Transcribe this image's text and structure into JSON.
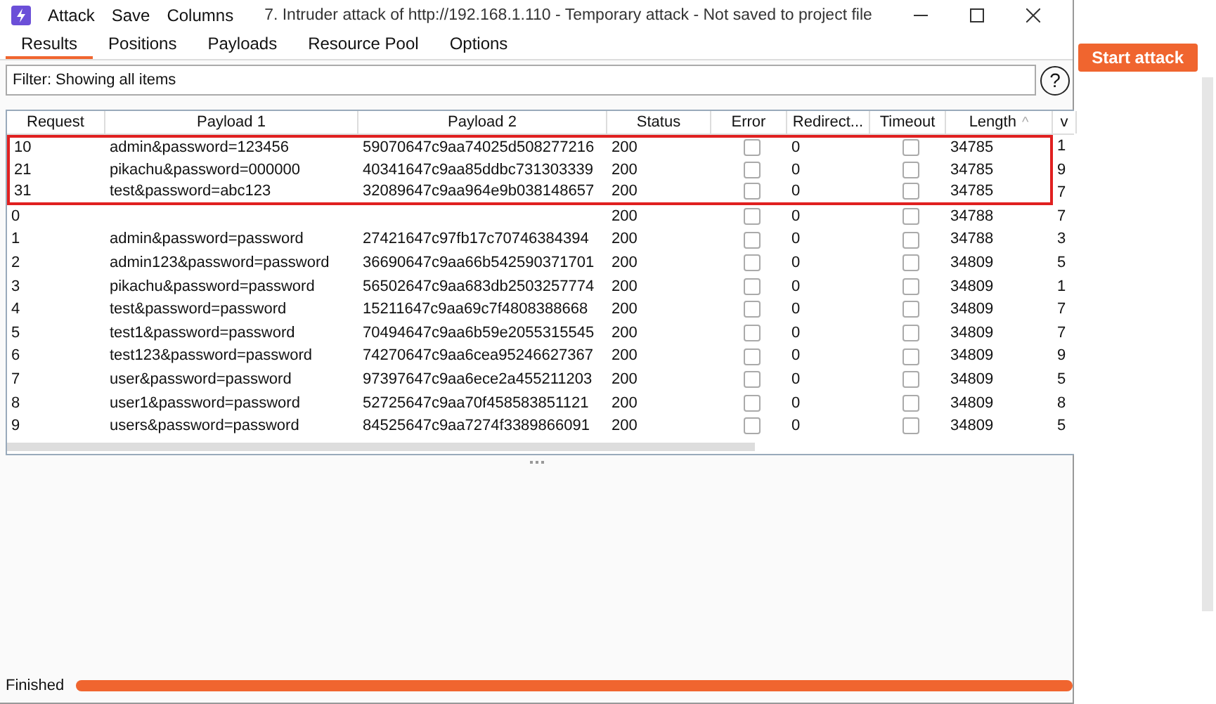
{
  "window": {
    "menu": [
      "Attack",
      "Save",
      "Columns"
    ],
    "title": "7. Intruder attack of http://192.168.1.110 - Temporary attack - Not saved to project file"
  },
  "tabs": [
    {
      "label": "Results",
      "selected": true
    },
    {
      "label": "Positions",
      "selected": false
    },
    {
      "label": "Payloads",
      "selected": false
    },
    {
      "label": "Resource Pool",
      "selected": false
    },
    {
      "label": "Options",
      "selected": false
    }
  ],
  "filter": {
    "text": "Filter: Showing all items",
    "help": "?"
  },
  "table": {
    "columns": [
      "Request",
      "Payload 1",
      "Payload 2",
      "Status",
      "Error",
      "Redirect...",
      "Timeout",
      "Length",
      "v"
    ],
    "sort_mark": "^",
    "rows": [
      {
        "request": "10",
        "payload_1": "admin&password=123456",
        "payload_2": "59070647c9aa74025d508277216",
        "status": "200",
        "error": false,
        "redirects": "0",
        "timeout": false,
        "length": "34785",
        "column_9": "1",
        "highlighted": true
      },
      {
        "request": "21",
        "payload_1": "pikachu&password=000000",
        "payload_2": "40341647c9aa85ddbc731303339",
        "status": "200",
        "error": false,
        "redirects": "0",
        "timeout": false,
        "length": "34785",
        "column_9": "9",
        "highlighted": true
      },
      {
        "request": "31",
        "payload_1": "test&password=abc123",
        "payload_2": "32089647c9aa964e9b038148657",
        "status": "200",
        "error": false,
        "redirects": "0",
        "timeout": false,
        "length": "34785",
        "column_9": "7",
        "highlighted": true
      },
      {
        "request": "0",
        "payload_1": "",
        "payload_2": "",
        "status": "200",
        "error": false,
        "redirects": "0",
        "timeout": false,
        "length": "34788",
        "column_9": "7",
        "highlighted": false
      },
      {
        "request": "1",
        "payload_1": "admin&password=password",
        "payload_2": "27421647c97fb17c70746384394",
        "status": "200",
        "error": false,
        "redirects": "0",
        "timeout": false,
        "length": "34788",
        "column_9": "3",
        "highlighted": false
      },
      {
        "request": "2",
        "payload_1": "admin123&password=password",
        "payload_2": "36690647c9aa66b542590371701",
        "status": "200",
        "error": false,
        "redirects": "0",
        "timeout": false,
        "length": "34809",
        "column_9": "5",
        "highlighted": false
      },
      {
        "request": "3",
        "payload_1": "pikachu&password=password",
        "payload_2": "56502647c9aa683db2503257774",
        "status": "200",
        "error": false,
        "redirects": "0",
        "timeout": false,
        "length": "34809",
        "column_9": "1",
        "highlighted": false
      },
      {
        "request": "4",
        "payload_1": "test&password=password",
        "payload_2": "15211647c9aa69c7f4808388668",
        "status": "200",
        "error": false,
        "redirects": "0",
        "timeout": false,
        "length": "34809",
        "column_9": "7",
        "highlighted": false
      },
      {
        "request": "5",
        "payload_1": "test1&password=password",
        "payload_2": "70494647c9aa6b59e2055315545",
        "status": "200",
        "error": false,
        "redirects": "0",
        "timeout": false,
        "length": "34809",
        "column_9": "7",
        "highlighted": false
      },
      {
        "request": "6",
        "payload_1": "test123&password=password",
        "payload_2": "74270647c9aa6cea95246627367",
        "status": "200",
        "error": false,
        "redirects": "0",
        "timeout": false,
        "length": "34809",
        "column_9": "9",
        "highlighted": false
      },
      {
        "request": "7",
        "payload_1": "user&password=password",
        "payload_2": "97397647c9aa6ece2a455211203",
        "status": "200",
        "error": false,
        "redirects": "0",
        "timeout": false,
        "length": "34809",
        "column_9": "5",
        "highlighted": false
      },
      {
        "request": "8",
        "payload_1": "user1&password=password",
        "payload_2": "52725647c9aa70f458583851121",
        "status": "200",
        "error": false,
        "redirects": "0",
        "timeout": false,
        "length": "34809",
        "column_9": "8",
        "highlighted": false
      },
      {
        "request": "9",
        "payload_1": "users&password=password",
        "payload_2": "84525647c9aa7274f3389866091",
        "status": "200",
        "error": false,
        "redirects": "0",
        "timeout": false,
        "length": "34809",
        "column_9": "5",
        "highlighted": false
      }
    ]
  },
  "start_button": "Start attack",
  "status_bar": {
    "text": "Finished",
    "level": 1
  }
}
